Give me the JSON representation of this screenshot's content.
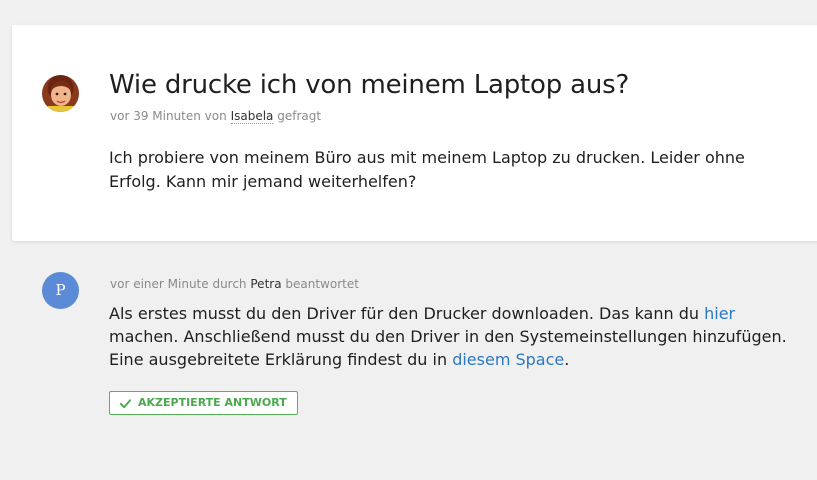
{
  "question": {
    "title": "Wie drucke ich von meinem Laptop aus?",
    "meta": {
      "prefix": "vor 39 Minuten von",
      "author": "Isabela",
      "suffix": "gefragt"
    },
    "body": "Ich probiere von meinem Büro aus mit meinem Laptop zu drucken. Leider ohne Erfolg. Kann mir jemand weiterhelfen?",
    "avatar": "user-photo-avatar"
  },
  "answer": {
    "avatar_initial": "P",
    "meta": {
      "prefix": "vor einer Minute durch",
      "author": "Petra",
      "suffix": "beantwortet"
    },
    "body": {
      "part1": "Als erstes musst du den Driver für den Drucker downloaden. Das kann du",
      "link1": "hier",
      "part2": "machen. Anschließend musst du den Driver in den Systemeinstellungen hinzufügen. Eine ausgebreitete Erklärung findest du in",
      "link2": "diesem Space",
      "part3": "."
    },
    "accepted_label": "AKZEPTIERTE ANTWORT",
    "accepted_icon": "check-icon"
  },
  "colors": {
    "background": "#f0f0f0",
    "card": "#ffffff",
    "link": "#2a78c2",
    "accepted": "#4aa94d",
    "avatar_initial_bg": "#5b8bd6"
  }
}
